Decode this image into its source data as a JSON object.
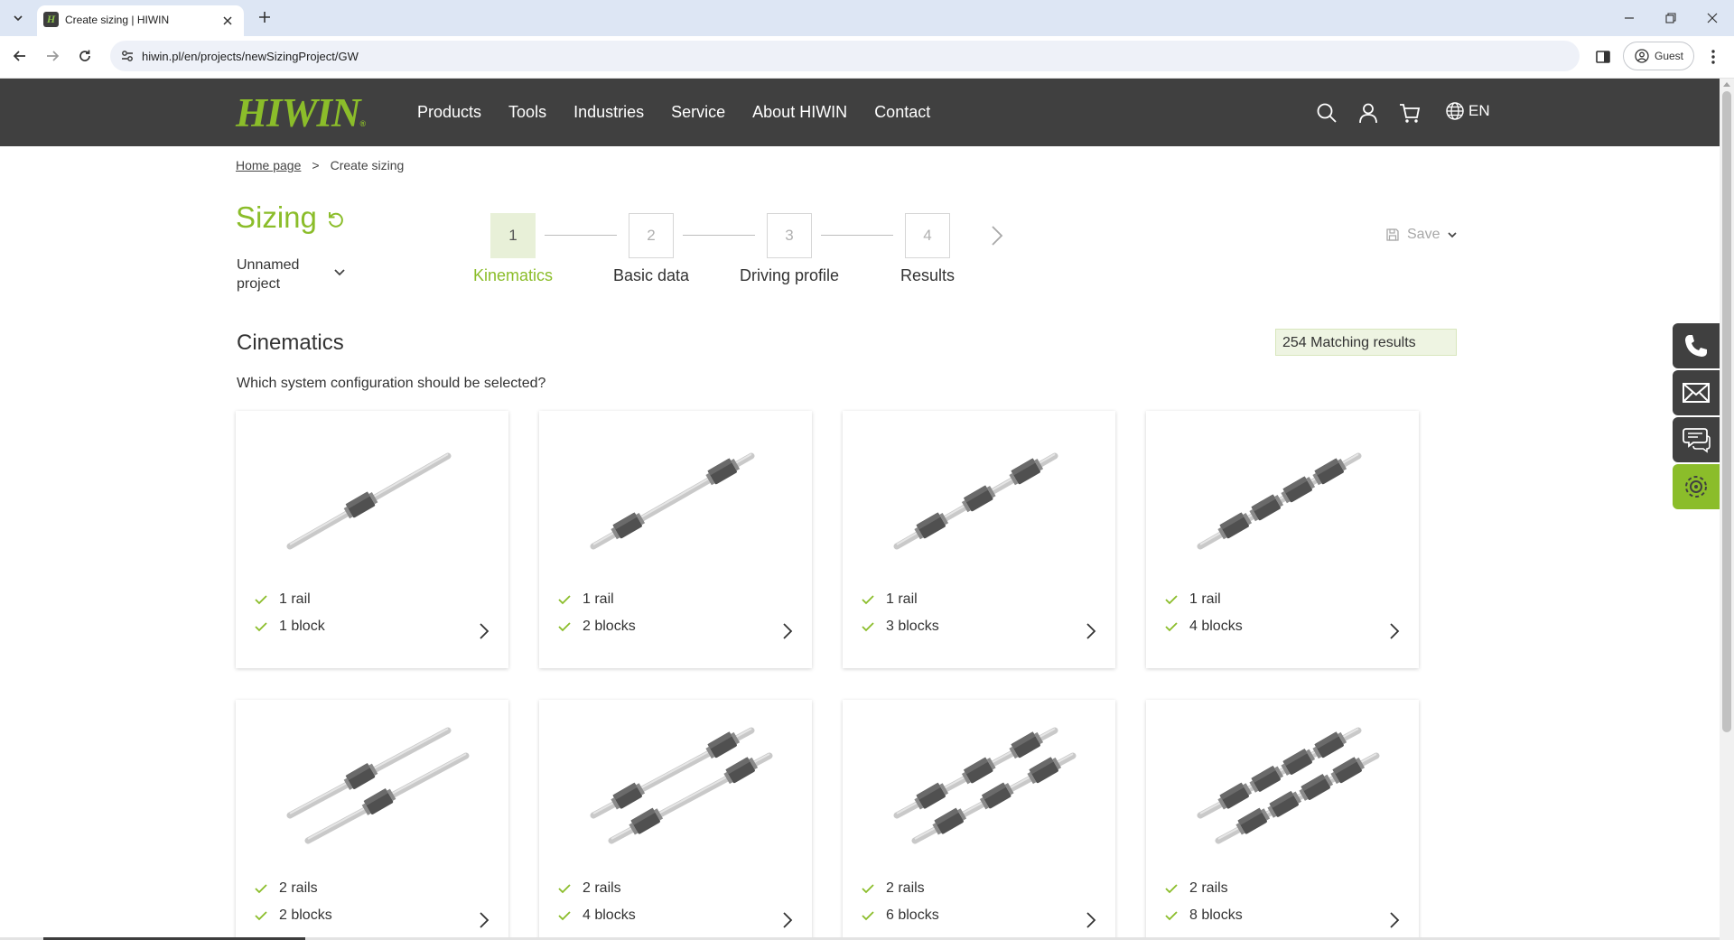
{
  "browser": {
    "tab_title": "Create sizing | HIWIN",
    "url": "hiwin.pl/en/projects/newSizingProject/GW",
    "profile_label": "Guest"
  },
  "header": {
    "logo_text": "HIWIN",
    "nav": [
      "Products",
      "Tools",
      "Industries",
      "Service",
      "About HIWIN",
      "Contact"
    ],
    "language": "EN"
  },
  "breadcrumb": {
    "home": "Home page",
    "separator": ">",
    "current": "Create sizing"
  },
  "project": {
    "title": "Sizing",
    "name": "Unnamed project"
  },
  "steps": [
    {
      "number": "1",
      "label": "Kinematics",
      "active": true
    },
    {
      "number": "2",
      "label": "Basic data",
      "active": false
    },
    {
      "number": "3",
      "label": "Driving profile",
      "active": false
    },
    {
      "number": "4",
      "label": "Results",
      "active": false
    }
  ],
  "save_label": "Save",
  "section": {
    "title": "Cinematics",
    "question": "Which system configuration should be selected?",
    "matching_results": "254 Matching results"
  },
  "configurations": [
    {
      "rails": "1 rail",
      "blocks": "1 block"
    },
    {
      "rails": "1 rail",
      "blocks": "2 blocks"
    },
    {
      "rails": "1 rail",
      "blocks": "3 blocks"
    },
    {
      "rails": "1 rail",
      "blocks": "4 blocks"
    },
    {
      "rails": "2 rails",
      "blocks": "2 blocks"
    },
    {
      "rails": "2 rails",
      "blocks": "4 blocks"
    },
    {
      "rails": "2 rails",
      "blocks": "6 blocks"
    },
    {
      "rails": "2 rails",
      "blocks": "8 blocks"
    }
  ],
  "colors": {
    "brand_green": "#8bbd2a",
    "header_bg": "#404040",
    "active_step_bg": "#e8f0d8"
  },
  "side_buttons": [
    "phone-icon",
    "mail-icon",
    "chat-icon",
    "gear-icon"
  ]
}
